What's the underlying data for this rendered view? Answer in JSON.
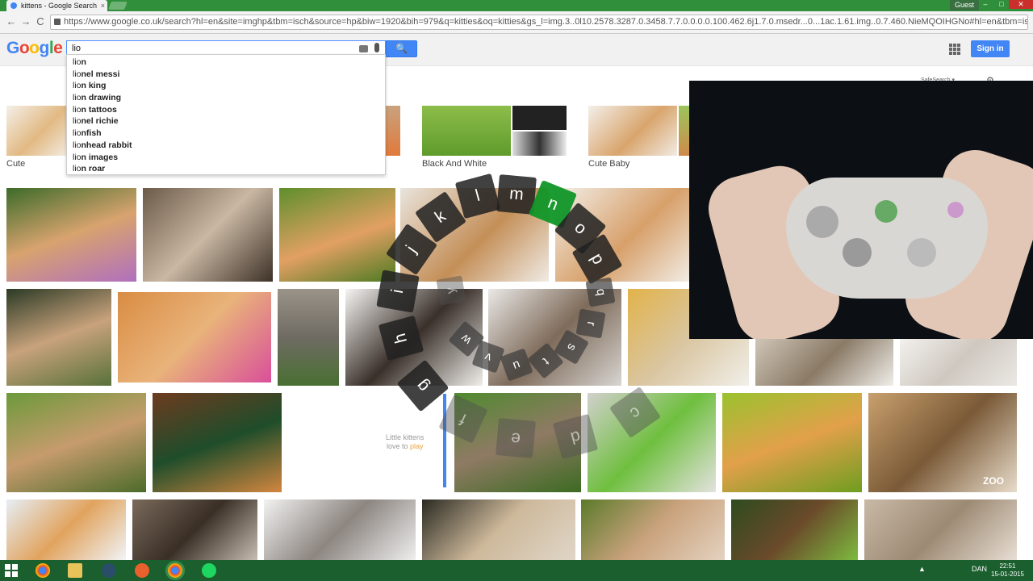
{
  "browser": {
    "tab_title": "kittens - Google Search",
    "tab_close": "×",
    "guest_label": "Guest",
    "url": "https://www.google.co.uk/search?hl=en&site=imghp&tbm=isch&source=hp&biw=1920&bih=979&q=kitties&oq=kitties&gs_l=img.3..0l10.2578.3287.0.3458.7.7.0.0.0.0.100.462.6j1.7.0.msedr...0...1ac.1.61.img..0.7.460.NieMQOIHGNo#hl=en&tbm=isch&q",
    "back": "←",
    "forward": "→",
    "reload": "C",
    "minimize": "–",
    "maximize": "□",
    "close": "✕"
  },
  "google": {
    "logo": [
      "G",
      "o",
      "o",
      "g",
      "l",
      "e"
    ],
    "search_value": "lio",
    "search_button": "🔍",
    "signin_label": "Sign in",
    "safesearch_label": "SafeSearch ▾",
    "gear": "⚙"
  },
  "suggestions": [
    {
      "typed": "lio",
      "rest": "n"
    },
    {
      "typed": "lio",
      "rest": "nel messi"
    },
    {
      "typed": "lio",
      "rest": "n king"
    },
    {
      "typed": "lio",
      "rest": "n drawing"
    },
    {
      "typed": "lio",
      "rest": "n tattoos"
    },
    {
      "typed": "lio",
      "rest": "nel richie"
    },
    {
      "typed": "lio",
      "rest": "nfish"
    },
    {
      "typed": "lio",
      "rest": "nhead rabbit"
    },
    {
      "typed": "lio",
      "rest": "n images"
    },
    {
      "typed": "lio",
      "rest": "n roar"
    }
  ],
  "related_searches": {
    "cute": "Cute",
    "black_and_white": "Black And White",
    "cute_baby": "Cute Baby"
  },
  "image_texts": {
    "little_kittens_1": "Little kittens",
    "little_kittens_2": "love to ",
    "little_kittens_3": "play",
    "zoo": "ZOO"
  },
  "radial_keyboard": {
    "keys": [
      "k",
      "l",
      "m",
      "n",
      "o",
      "p",
      "q",
      "r",
      "s",
      "t",
      "u",
      "v",
      "w",
      "y",
      "j",
      "i",
      "h",
      "g",
      "f",
      "e",
      "d",
      "c"
    ],
    "active_key": "n"
  },
  "taskbar": {
    "language": "DAN",
    "time": "22:51",
    "date": "15-01-2015",
    "tray_arrow": "▲"
  },
  "colors": {
    "chrome_green": "#2f8f3a",
    "taskbar_green": "#1a5f2d",
    "google_blue": "#4285f4",
    "active_key_green": "#109628"
  }
}
